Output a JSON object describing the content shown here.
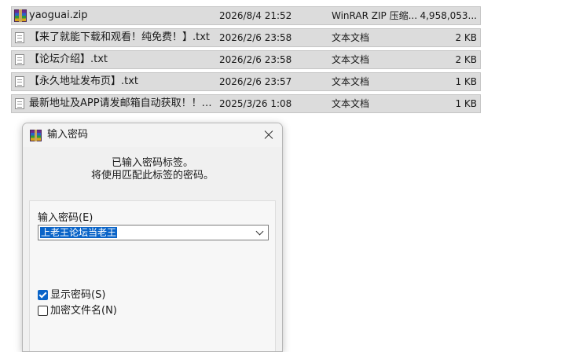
{
  "files": [
    {
      "icon": "winrar-archive-icon",
      "name": "yaoguai.zip",
      "date": "2026/8/4 21:52",
      "type": "WinRAR ZIP 压缩...",
      "size": "4,958,053..."
    },
    {
      "icon": "text-file-icon",
      "name": "【来了就能下载和观看！纯免费！】.txt",
      "date": "2026/2/6 23:58",
      "type": "文本文档",
      "size": "2 KB"
    },
    {
      "icon": "text-file-icon",
      "name": "【论坛介绍】.txt",
      "date": "2026/2/6 23:58",
      "type": "文本文档",
      "size": "2 KB"
    },
    {
      "icon": "text-file-icon",
      "name": "【永久地址发布页】.txt",
      "date": "2026/2/6 23:57",
      "type": "文本文档",
      "size": "1 KB"
    },
    {
      "icon": "text-file-icon",
      "name": "最新地址及APP请发邮箱自动获取！！！....",
      "date": "2025/3/26 1:08",
      "type": "文本文档",
      "size": "1 KB"
    }
  ],
  "dialog": {
    "title": "输入密码",
    "icon": "winrar-icon",
    "message_line1": "已输入密码标签。",
    "message_line2": "将使用匹配此标签的密码。",
    "password_label": "输入密码(E)",
    "password_value": "上老王论坛当老王",
    "show_password_label": "显示密码(S)",
    "show_password_checked": true,
    "encrypt_names_label": "加密文件名(N)",
    "encrypt_names_checked": false
  },
  "colors": {
    "accent": "#0a64c8",
    "row_selected_bg": "#dcdcdc"
  }
}
